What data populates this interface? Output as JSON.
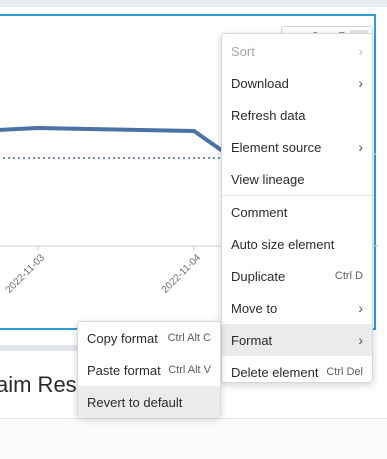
{
  "chart_data": {
    "type": "line",
    "x_tick_labels": [
      "2022-11-03",
      "2022-11-04"
    ],
    "series": [
      {
        "style": "solid",
        "color": "#4a72a3"
      },
      {
        "style": "dotted",
        "color": "#6f8fb8"
      }
    ]
  },
  "toolbar": {
    "icons": [
      "drag-handle-icon",
      "chart-add-icon",
      "expand-icon",
      "more-vertical-icon"
    ]
  },
  "section": {
    "title_visible": "aim Res"
  },
  "main_menu": {
    "items": [
      {
        "label": "Sort",
        "disabled": true,
        "submenu": true
      },
      {
        "label": "Download",
        "submenu": true
      },
      {
        "label": "Refresh data"
      },
      {
        "label": "Element source",
        "submenu": true
      },
      {
        "label": "View lineage"
      },
      {
        "label": "Comment"
      },
      {
        "label": "Auto size element"
      },
      {
        "label": "Duplicate",
        "shortcut": "Ctrl D"
      },
      {
        "label": "Move to",
        "submenu": true
      },
      {
        "label": "Format",
        "submenu": true,
        "highlighted": true
      },
      {
        "label": "Delete element",
        "shortcut": "Ctrl Del"
      }
    ]
  },
  "format_menu": {
    "items": [
      {
        "label": "Copy format",
        "shortcut": "Ctrl Alt C"
      },
      {
        "label": "Paste format",
        "shortcut": "Ctrl Alt V"
      },
      {
        "label": "Revert to default",
        "highlighted": true
      }
    ]
  },
  "colors": {
    "selection_border": "#2b9fd6",
    "line": "#4a72a3",
    "menu_hover": "#e9ebed"
  }
}
